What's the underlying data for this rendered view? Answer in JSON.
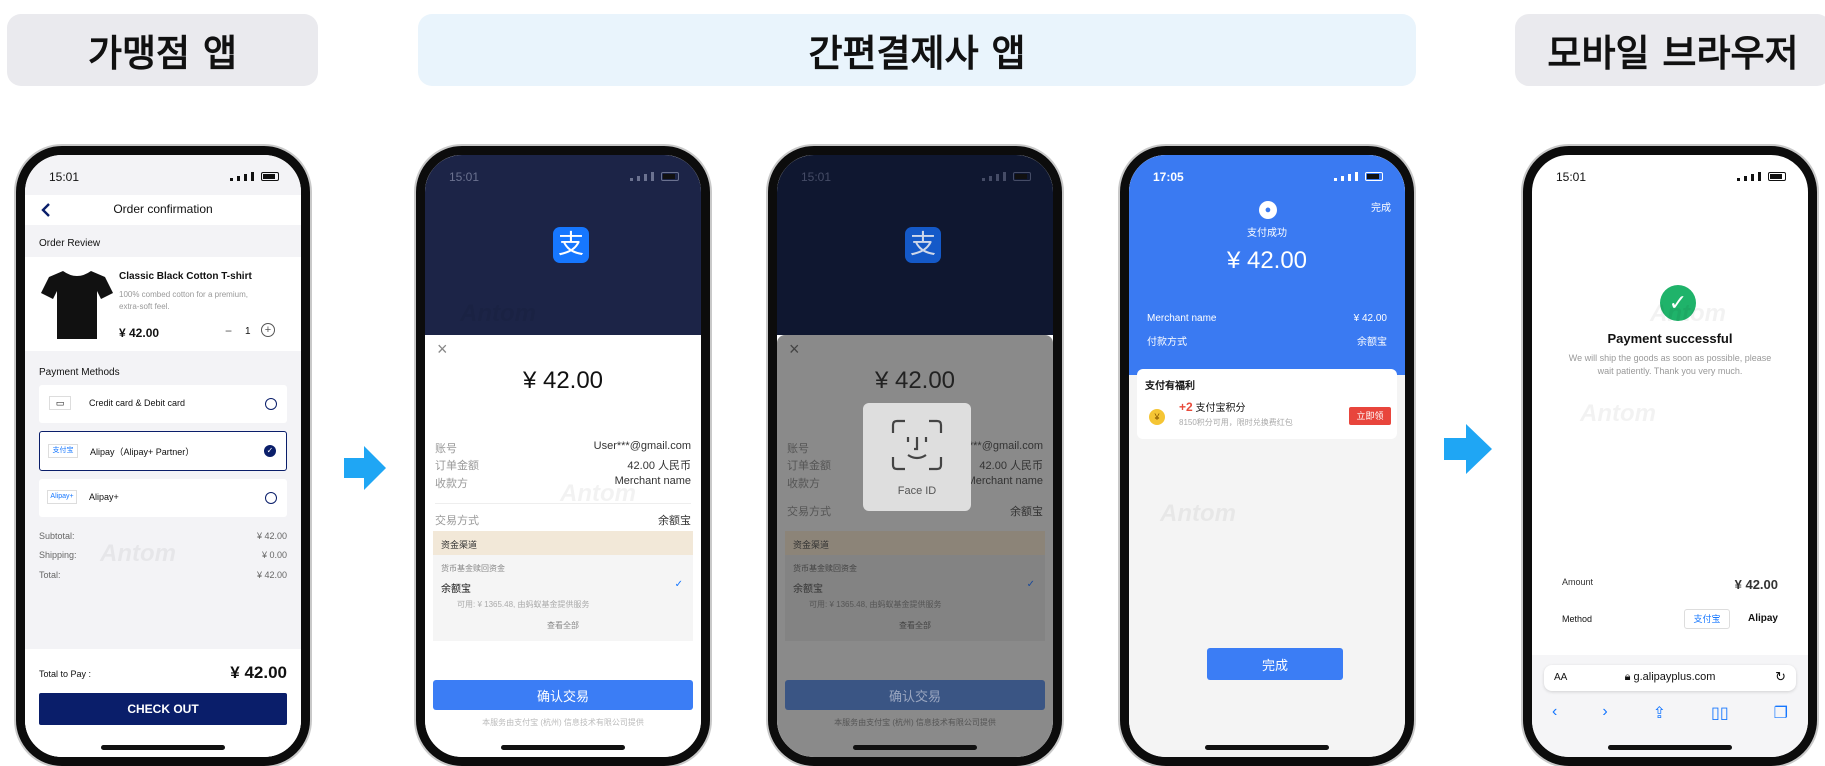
{
  "headers": {
    "merchant": "가맹점 앱",
    "wallet": "간편결제사 앱",
    "browser": "모바일 브라우저"
  },
  "colors": {
    "header_gray": "#eaeaee",
    "header_blue": "#e9f4fc",
    "arrow": "#1fa6f4",
    "navy": "#0a1e6a",
    "alipay_blue": "#1677ff",
    "success_green": "#1fb36a"
  },
  "phone1": {
    "time": "15:01",
    "title": "Order confirmation",
    "order_review": "Order Review",
    "product_name": "Classic Black Cotton T-shirt",
    "product_desc": "100% combed cotton for a premium, extra-soft feel.",
    "price": "¥ 42.00",
    "qty": "1",
    "payment_methods": "Payment Methods",
    "methods": [
      "Credit card & Debit card",
      "Alipay（Alipay+ Partner）",
      "Alipay+"
    ],
    "alipay_badge": "支付宝",
    "alipayplus_badge": "Alipay+",
    "summary": [
      {
        "label": "Subtotal:",
        "value": "¥ 42.00"
      },
      {
        "label": "Shipping:",
        "value": "¥ 0.00"
      },
      {
        "label": "Total:",
        "value": "¥ 42.00"
      }
    ],
    "total_to_pay_label": "Total to Pay :",
    "total_to_pay": "¥ 42.00",
    "checkout": "CHECK OUT"
  },
  "phone2": {
    "time": "15:01",
    "amount": "¥ 42.00",
    "rows": [
      {
        "label": "账号",
        "value": "User***@gmail.com"
      },
      {
        "label": "订单金额",
        "value": "42.00 人民币"
      },
      {
        "label": "收款方",
        "value": "Merchant name"
      }
    ],
    "pay_method_label": "交易方式",
    "pay_method_value": "余额宝",
    "channel_title": "资金渠道",
    "channel_sub": "货币基金赎回资金",
    "channel_item": "余额宝",
    "channel_avail": "可用: ¥ 1365.48, 由蚂蚁基金提供服务",
    "view_all": "查看全部",
    "confirm": "确认交易",
    "footer": "本服务由支付宝 (杭州) 信息技术有限公司提供"
  },
  "phone3": {
    "time": "15:01",
    "amount": "¥ 42.00",
    "face_id": "Face ID",
    "rows": [
      {
        "label": "账号",
        "value": "User***@gmail.com"
      },
      {
        "label": "订单金额",
        "value": "42.00 人民币"
      },
      {
        "label": "收款方",
        "value": "Merchant name"
      }
    ],
    "pay_method_label": "交易方式",
    "pay_method_value": "余额宝",
    "channel_title": "资金渠道",
    "channel_sub": "货币基金赎回资金",
    "channel_item": "余额宝",
    "channel_avail": "可用: ¥ 1365.48, 由蚂蚁基金提供服务",
    "view_all": "查看全部",
    "confirm": "确认交易",
    "footer": "本服务由支付宝 (杭州) 信息技术有限公司提供"
  },
  "phone4": {
    "time": "17:05",
    "done_top": "完成",
    "success": "支付成功",
    "amount": "¥ 42.00",
    "merchant_label": "Merchant name",
    "merchant_value": "¥ 42.00",
    "method_label": "付款方式",
    "method_value": "余额宝",
    "benefit_title": "支付有福利",
    "points": "+2",
    "points_label": "支付宝积分",
    "points_sub": "8150积分可用，限时兑换费红包",
    "claim": "立即领",
    "done_btn": "完成"
  },
  "phone5": {
    "time": "15:01",
    "title": "Payment successful",
    "desc": "We will ship the goods as soon as possible, please wait patiently. Thank you very much.",
    "amount_label": "Amount",
    "amount_value": "¥ 42.00",
    "method_label": "Method",
    "method_badge": "支付宝",
    "method_value": "Alipay",
    "url": "g.alipayplus.com",
    "aa": "AA"
  },
  "watermark": "Antom"
}
